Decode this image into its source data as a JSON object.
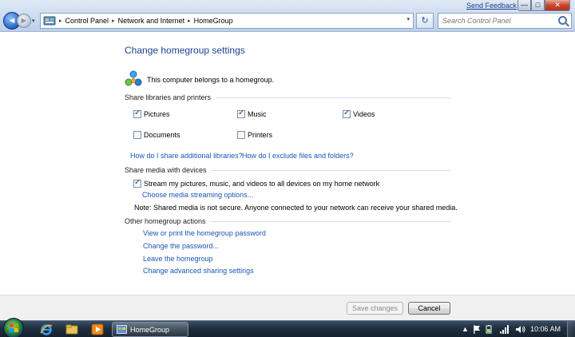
{
  "window": {
    "feedback_label": "Send Feedback",
    "minimize_glyph": "—",
    "maximize_glyph": "□",
    "close_glyph": "✕"
  },
  "nav": {
    "back_glyph": "◄",
    "forward_glyph": "►",
    "recent_glyph": "▾"
  },
  "address": {
    "breadcrumbs": [
      "Control Panel",
      "Network and Internet",
      "HomeGroup"
    ],
    "separator": "▸",
    "dropdown_glyph": "▾",
    "refresh_glyph": "↻"
  },
  "search": {
    "placeholder": "Search Control Panel"
  },
  "page": {
    "title": "Change homegroup settings",
    "belongs_text": "This computer belongs to a homegroup."
  },
  "libraries": {
    "section_label": "Share libraries and printers",
    "items": [
      {
        "label": "Pictures",
        "checked": true
      },
      {
        "label": "Music",
        "checked": true
      },
      {
        "label": "Videos",
        "checked": true
      },
      {
        "label": "Documents",
        "checked": false
      },
      {
        "label": "Printers",
        "checked": false
      }
    ],
    "link_share_more": "How do I share additional libraries?",
    "link_exclude": "How do I exclude files and folders?"
  },
  "media": {
    "section_label": "Share media with devices",
    "stream_label": "Stream my pictures, music, and videos to all devices on my home network",
    "stream_checked": true,
    "options_link": "Choose media streaming options...",
    "note": "Note: Shared media is not secure. Anyone connected to your network can receive your shared media."
  },
  "actions": {
    "section_label": "Other homegroup actions",
    "links": [
      "View or print the homegroup password",
      "Change the password...",
      "Leave the homegroup",
      "Change advanced sharing settings"
    ]
  },
  "buttons": {
    "save": "Save changes",
    "cancel": "Cancel"
  },
  "taskbar": {
    "task_label": "HomeGroup",
    "tray_arrow": "▲",
    "clock": "10:06 AM"
  },
  "colors": {
    "link": "#1a56b8",
    "title": "#1e3f8f",
    "taskbar": "#1f2e3e"
  }
}
